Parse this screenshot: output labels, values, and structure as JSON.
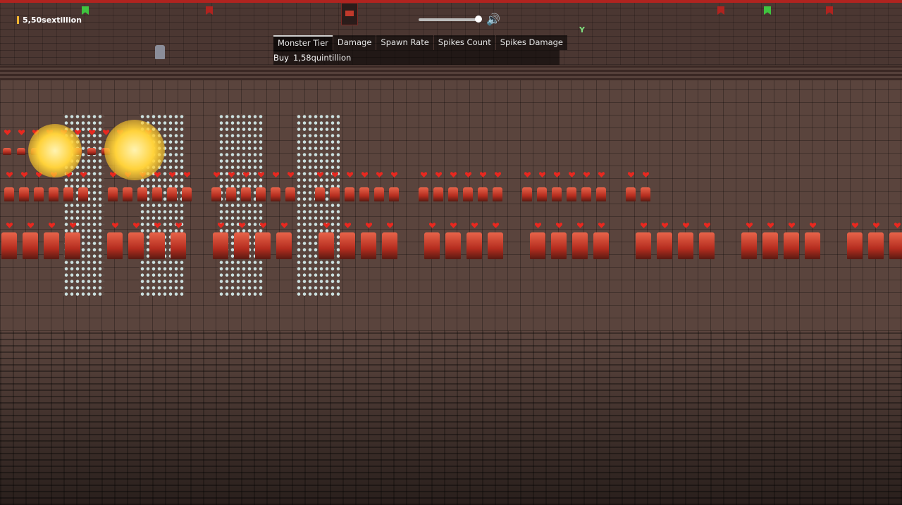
{
  "hud": {
    "gold_amount": "5,50sextillion",
    "icons": [
      "coin-icon",
      "flag-icon",
      "speaker-icon"
    ],
    "volume_level": 0.93
  },
  "upgrade_panel": {
    "tabs": [
      {
        "label": "Monster Tier",
        "active": true
      },
      {
        "label": "Damage",
        "active": false
      },
      {
        "label": "Spawn Rate",
        "active": false
      },
      {
        "label": "Spikes Count",
        "active": false
      },
      {
        "label": "Spikes Damage",
        "active": false
      }
    ],
    "buy_label": "Buy",
    "buy_price": "1,58quintillion"
  },
  "colors": {
    "accent_red": "#b0231f",
    "flag_green": "#3fc43f",
    "flag_red": "#b0231f",
    "coin": "#f2b631",
    "heart": "#e8281f"
  }
}
